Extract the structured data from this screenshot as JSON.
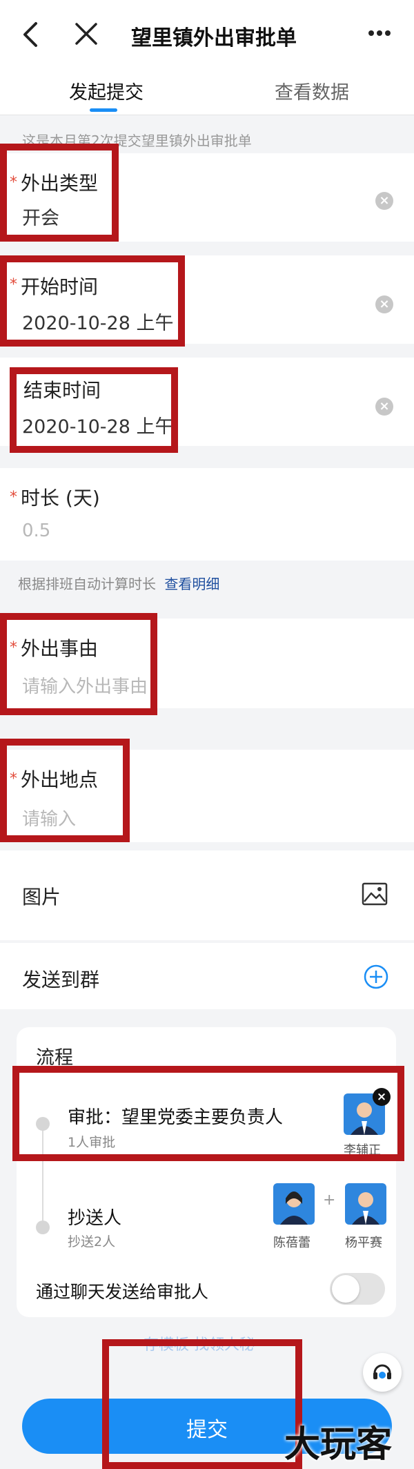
{
  "header": {
    "title": "望里镇外出审批单",
    "back_icon": "chevron-left-icon",
    "close_icon": "close-icon",
    "more_icon": "more-dots-icon"
  },
  "tabs": [
    {
      "label": "发起提交",
      "active": true
    },
    {
      "label": "查看数据",
      "active": false
    }
  ],
  "notice": "这是本月第2次提交望里镇外出审批单",
  "fields": {
    "out_type": {
      "label": "外出类型",
      "value": "开会"
    },
    "start_time": {
      "label": "开始时间",
      "value": "2020-10-28 上午"
    },
    "end_time": {
      "label": "结束时间",
      "value": "2020-10-28 上午"
    },
    "duration": {
      "label": "时长 (天)",
      "value": "0.5"
    },
    "reason": {
      "label": "外出事由",
      "placeholder": "请输入外出事由"
    },
    "location": {
      "label": "外出地点",
      "placeholder": "请输入"
    }
  },
  "duration_hint": {
    "text": "根据排班自动计算时长",
    "link": "查看明细"
  },
  "required_mark": "*",
  "picture": {
    "label": "图片"
  },
  "send_group": {
    "label": "发送到群"
  },
  "process": {
    "title": "流程",
    "approval": {
      "title": "审批：望里党委主要负责人",
      "sub": "1人审批",
      "person": "李辅正"
    },
    "cc": {
      "title": "抄送人",
      "sub": "抄送2人",
      "people": [
        "陈蓓蕾",
        "杨平赛"
      ],
      "plus": "+"
    },
    "chat_toggle": {
      "label": "通过聊天发送给审批人",
      "on": false
    }
  },
  "bottom_partial_text": "存模板 找领人秘",
  "submit": {
    "label": "提交"
  },
  "watermark": "大玩客",
  "colors": {
    "accent": "#1a8ef5",
    "annotation_red": "#b5171b"
  }
}
